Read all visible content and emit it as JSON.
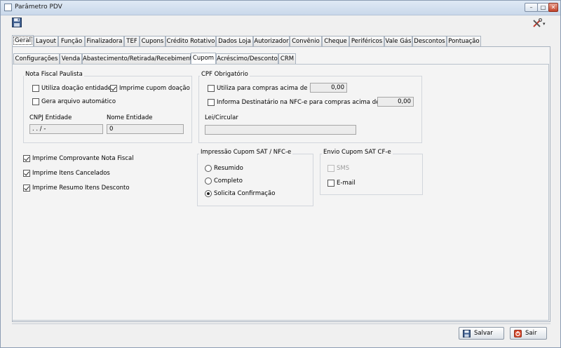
{
  "window": {
    "title": "Parâmetro PDV",
    "minimize": "–",
    "maximize": "□",
    "close": "✕"
  },
  "toolbar": {
    "save_icon": "floppy-disk-icon",
    "tools_icon": "tools-icon",
    "caret": "▾"
  },
  "main_tabs": [
    "Geral",
    "Layout",
    "Função",
    "Finalizadora",
    "TEF",
    "Cupons",
    "Crédito Rotativo",
    "Dados Loja",
    "Autorizador",
    "Convênio",
    "Cheque",
    "Periféricos",
    "Vale Gás",
    "Descontos",
    "Pontuação"
  ],
  "main_tabs_active": "Geral",
  "sub_tabs": [
    "Configurações",
    "Venda",
    "Abastecimento/Retirada/Recebimento",
    "Cupom",
    "Acréscimo/Desconto",
    "CRM"
  ],
  "sub_tabs_active": "Cupom",
  "nota_fiscal_paulista": {
    "title": "Nota Fiscal Paulista",
    "utiliza_doacao": {
      "label": "Utiliza doação entidade",
      "checked": false
    },
    "imprime_cupom_doacao": {
      "label": "Imprime cupom doação",
      "checked": true
    },
    "gera_arquivo": {
      "label": "Gera arquivo automático",
      "checked": false
    },
    "cnpj_label": "CNPJ Entidade",
    "cnpj_value": "  .  .   /    -",
    "nome_label": "Nome Entidade",
    "nome_value": "0"
  },
  "cpf_obrigatorio": {
    "title": "CPF Obrigatório",
    "utiliza_compras": {
      "label": "Utiliza para compras acima de R$",
      "checked": false,
      "value": "0,00"
    },
    "informa_destinatario": {
      "label": "Informa Destinatário na NFC-e para compras acima de R$",
      "checked": false,
      "value": "0,00"
    },
    "lei_label": "Lei/Circular",
    "lei_value": ""
  },
  "options": [
    {
      "label": "Imprime Comprovante Nota Fiscal",
      "checked": true
    },
    {
      "label": "Imprime Itens Cancelados",
      "checked": true
    },
    {
      "label": "Imprime Resumo Itens Desconto",
      "checked": true
    }
  ],
  "impressao_cupom": {
    "title": "Impressão Cupom SAT / NFC-e",
    "options": [
      "Resumido",
      "Completo",
      "Solicita Confirmação"
    ],
    "selected": "Solicita Confirmação"
  },
  "envio_cupom": {
    "title": "Envio Cupom SAT CF-e",
    "sms": {
      "label": "SMS",
      "checked": false,
      "enabled": false
    },
    "email": {
      "label": "E-mail",
      "checked": false
    }
  },
  "buttons": {
    "save_label": "Salvar",
    "exit_label": "Sair"
  },
  "colors": {
    "title_gradient_top": "#dfe9f5",
    "close_red": "#c2432a",
    "panel_bg": "#f4f4f4"
  }
}
